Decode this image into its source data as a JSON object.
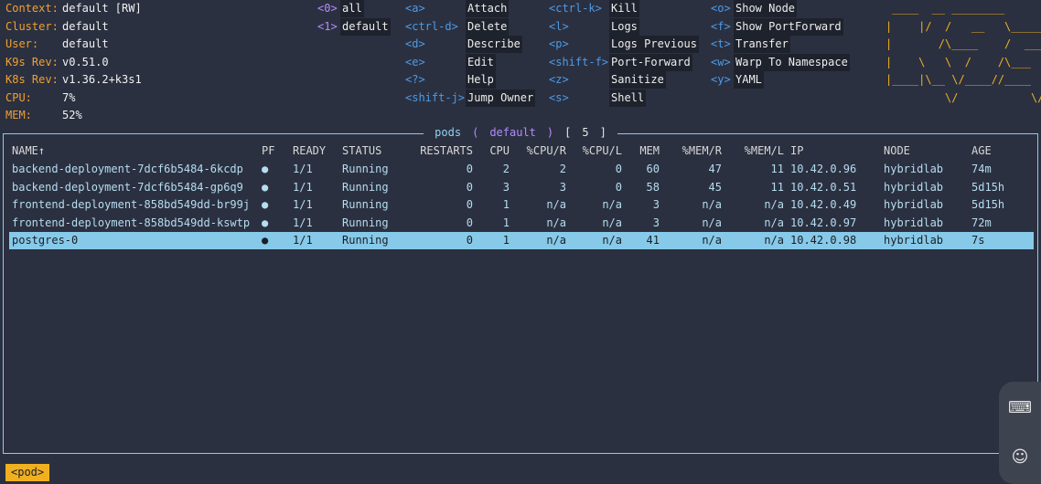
{
  "info": [
    {
      "label": "Context:",
      "value": "default [RW]"
    },
    {
      "label": "Cluster:",
      "value": "default"
    },
    {
      "label": "User:",
      "value": "default"
    },
    {
      "label": "K9s Rev:",
      "value": "v0.51.0"
    },
    {
      "label": "K8s Rev:",
      "value": "v1.36.2+k3s1"
    },
    {
      "label": "CPU:",
      "value": "7%"
    },
    {
      "label": "MEM:",
      "value": "52%"
    }
  ],
  "namespaces": [
    {
      "key": "<0>",
      "label": "all"
    },
    {
      "key": "<1>",
      "label": "default"
    }
  ],
  "hotkeys": {
    "col1": [
      {
        "key": "<a>",
        "label": "Attach"
      },
      {
        "key": "<ctrl-d>",
        "label": "Delete"
      },
      {
        "key": "<d>",
        "label": "Describe"
      },
      {
        "key": "<e>",
        "label": "Edit"
      },
      {
        "key": "<?>",
        "label": "Help"
      },
      {
        "key": "<shift-j>",
        "label": "Jump Owner"
      }
    ],
    "col2": [
      {
        "key": "<ctrl-k>",
        "label": "Kill"
      },
      {
        "key": "<l>",
        "label": "Logs"
      },
      {
        "key": "<p>",
        "label": "Logs Previous"
      },
      {
        "key": "<shift-f>",
        "label": "Port-Forward"
      },
      {
        "key": "<z>",
        "label": "Sanitize"
      },
      {
        "key": "<s>",
        "label": "Shell"
      }
    ],
    "col3": [
      {
        "key": "<o>",
        "label": "Show Node"
      },
      {
        "key": "<f>",
        "label": "Show PortForward"
      },
      {
        "key": "<t>",
        "label": "Transfer"
      },
      {
        "key": "<w>",
        "label": "Warp To Namespace"
      },
      {
        "key": "<y>",
        "label": "YAML"
      }
    ]
  },
  "logo": [
    " ____  __ ________       ",
    "|    |/  /   __   \\______",
    "|       /\\____    /  ___/",
    "|    \\   \\  /    /\\___  \\",
    "|____|\\__ \\/____//____  /",
    "         \\/           \\/ "
  ],
  "pane": {
    "resource": "pods",
    "namespace": "default",
    "count": "5"
  },
  "columns": [
    "NAME↑",
    "PF",
    "READY",
    "STATUS",
    "RESTARTS",
    "CPU",
    "%CPU/R",
    "%CPU/L",
    "MEM",
    "%MEM/R",
    "%MEM/L",
    "IP",
    "NODE",
    "AGE"
  ],
  "rows": [
    [
      "backend-deployment-7dcf6b5484-6kcdp",
      "●",
      "1/1",
      "Running",
      "0",
      "2",
      "2",
      "0",
      "60",
      "47",
      "11",
      "10.42.0.96",
      "hybridlab",
      "74m"
    ],
    [
      "backend-deployment-7dcf6b5484-gp6q9",
      "●",
      "1/1",
      "Running",
      "0",
      "3",
      "3",
      "0",
      "58",
      "45",
      "11",
      "10.42.0.51",
      "hybridlab",
      "5d15h"
    ],
    [
      "frontend-deployment-858bd549dd-br99j",
      "●",
      "1/1",
      "Running",
      "0",
      "1",
      "n/a",
      "n/a",
      "3",
      "n/a",
      "n/a",
      "10.42.0.49",
      "hybridlab",
      "5d15h"
    ],
    [
      "frontend-deployment-858bd549dd-kswtp",
      "●",
      "1/1",
      "Running",
      "0",
      "1",
      "n/a",
      "n/a",
      "3",
      "n/a",
      "n/a",
      "10.42.0.97",
      "hybridlab",
      "72m"
    ],
    [
      "postgres-0",
      "●",
      "1/1",
      "Running",
      "0",
      "1",
      "n/a",
      "n/a",
      "41",
      "n/a",
      "n/a",
      "10.42.0.98",
      "hybridlab",
      "7s"
    ]
  ],
  "selected_row": 4,
  "breadcrumb": "<pod>",
  "side_icons": [
    {
      "name": "keyboard-icon",
      "glyph": "⌨"
    },
    {
      "name": "emoji-icon",
      "glyph": "☺"
    }
  ]
}
